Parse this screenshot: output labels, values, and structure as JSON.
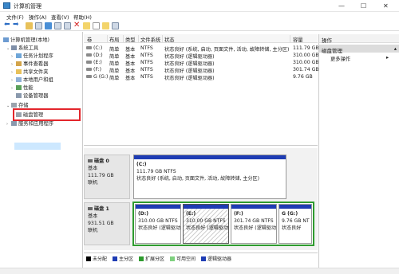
{
  "window": {
    "title": "计算机管理",
    "min": "—",
    "max": "☐",
    "close": "✕"
  },
  "menu": [
    "文件(F)",
    "操作(A)",
    "查看(V)",
    "帮助(H)"
  ],
  "tree": {
    "root": "计算机管理(本地)",
    "system_tools": "系统工具",
    "task_scheduler": "任务计划程序",
    "event_viewer": "事件查看器",
    "shared_folders": "共享文件夹",
    "local_users": "本地用户和组",
    "performance": "性能",
    "device_manager": "设备管理器",
    "storage": "存储",
    "disk_management": "磁盘管理",
    "services_apps": "服务和应用程序"
  },
  "table": {
    "headers": [
      "卷",
      "布局",
      "类型",
      "文件系统",
      "状态",
      "容量"
    ],
    "rows": [
      {
        "vol": "(C:)",
        "layout": "简单",
        "type": "基本",
        "fs": "NTFS",
        "status": "状态良好 (系统, 启动, 页面文件, 活动, 故障转储, 主分区)",
        "cap": "111.79 GB"
      },
      {
        "vol": "(D:)",
        "layout": "简单",
        "type": "基本",
        "fs": "NTFS",
        "status": "状态良好 (逻辑驱动器)",
        "cap": "310.00 GB"
      },
      {
        "vol": "(E:)",
        "layout": "简单",
        "type": "基本",
        "fs": "NTFS",
        "status": "状态良好 (逻辑驱动器)",
        "cap": "310.00 GB"
      },
      {
        "vol": "(F:)",
        "layout": "简单",
        "type": "基本",
        "fs": "NTFS",
        "status": "状态良好 (逻辑驱动器)",
        "cap": "301.74 GB"
      },
      {
        "vol": "G (G:)",
        "layout": "简单",
        "type": "基本",
        "fs": "NTFS",
        "status": "状态良好 (逻辑驱动器)",
        "cap": "9.76 GB"
      }
    ]
  },
  "disk0": {
    "name": "磁盘 0",
    "type": "基本",
    "size": "111.79 GB",
    "state": "联机",
    "vol": {
      "name": "(C:)",
      "size": "111.79 GB NTFS",
      "status": "状态良好 (系统, 启动, 页面文件, 活动, 故障转储, 主分区)"
    }
  },
  "disk1": {
    "name": "磁盘 1",
    "type": "基本",
    "size": "931.51 GB",
    "state": "联机",
    "vols": [
      {
        "name": "(D:)",
        "size": "310.00 GB NTFS",
        "status": "状态良好 (逻辑驱动"
      },
      {
        "name": "(E:)",
        "size": "310.00 GB NTFS",
        "status": "状态良好 (逻辑驱动"
      },
      {
        "name": "(F:)",
        "size": "301.74 GB NTFS",
        "status": "状态良好 (逻辑驱动"
      },
      {
        "name": "G (G:)",
        "size": "9.76 GB NT",
        "status": "状态良好"
      }
    ]
  },
  "legend": [
    {
      "label": "未分配",
      "color": "#000000"
    },
    {
      "label": "主分区",
      "color": "#1e3cb4"
    },
    {
      "label": "扩展分区",
      "color": "#2e9b2e"
    },
    {
      "label": "可用空间",
      "color": "#7fd07f"
    },
    {
      "label": "逻辑驱动器",
      "color": "#1e3cb4"
    }
  ],
  "actions": {
    "header": "操作",
    "selected": "磁盘管理",
    "more": "更多操作"
  },
  "colors": {
    "primary": "#1e3cb4",
    "extended": "#2e9b2e",
    "highlight": "#e3262c"
  }
}
